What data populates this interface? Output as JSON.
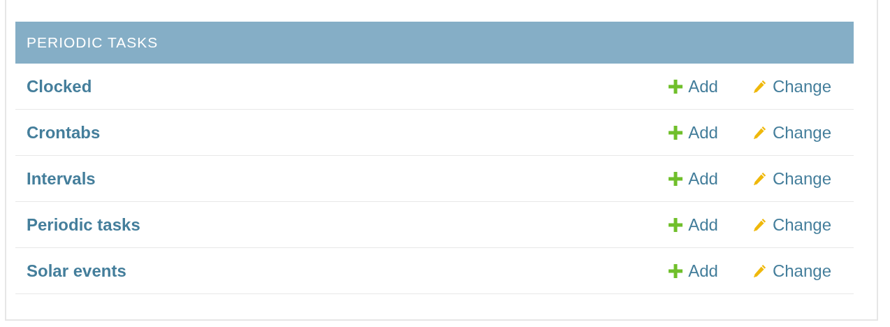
{
  "module": {
    "caption": "PERIODIC TASKS",
    "rows": [
      {
        "name": "Clocked",
        "add": "Add",
        "change": "Change"
      },
      {
        "name": "Crontabs",
        "add": "Add",
        "change": "Change"
      },
      {
        "name": "Intervals",
        "add": "Add",
        "change": "Change"
      },
      {
        "name": "Periodic tasks",
        "add": "Add",
        "change": "Change"
      },
      {
        "name": "Solar events",
        "add": "Add",
        "change": "Change"
      }
    ]
  }
}
